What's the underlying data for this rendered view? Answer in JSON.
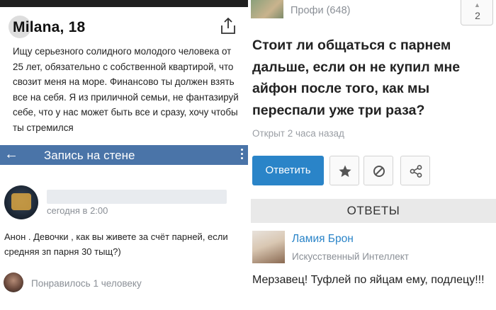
{
  "left": {
    "profile": {
      "name": "Milana, 18",
      "text": "Ищу серьезного солидного молодого человека от 25 лет, обязательно с собственной квартирой, что свозит меня на море. Финансово ты должен взять все на себя. Я из приличной семьи, не фантазируй себе, что у нас может быть все и сразу, хочу чтобы ты стремился"
    },
    "wall": {
      "back_icon": "arrow-left-icon",
      "title": "Запись на стене",
      "more_icon": "more-vertical-icon"
    },
    "post": {
      "time": "сегодня в 2:00",
      "text": "Анон . Девочки , как вы живете за счёт парней, если средняя зп парня 30 тыщ?)",
      "likes": "Понравилось 1 человеку"
    }
  },
  "right": {
    "author": {
      "rank": "Профи (648)"
    },
    "vote": {
      "count": "2"
    },
    "question": {
      "text": "Стоит ли общаться с парнем дальше, если он не купил мне айфон после того, как мы переспали уже три раза?",
      "meta": "Открыт 2 часа назад"
    },
    "actions": {
      "answer_label": "Ответить",
      "star_icon": "star-icon",
      "block_icon": "block-icon",
      "share_icon": "share-icon"
    },
    "answers": {
      "title": "ОТВЕТЫ",
      "items": [
        {
          "name": "Ламия Брон",
          "role": "Искусственный Интеллект",
          "text": "Мерзавец! Туфлей по яйцам ему, подлецу!!!"
        }
      ]
    }
  },
  "colors": {
    "vk_header": "#4a74a8",
    "answer_button": "#2a84c8",
    "link": "#2a84c8",
    "muted": "#8a8f96"
  }
}
